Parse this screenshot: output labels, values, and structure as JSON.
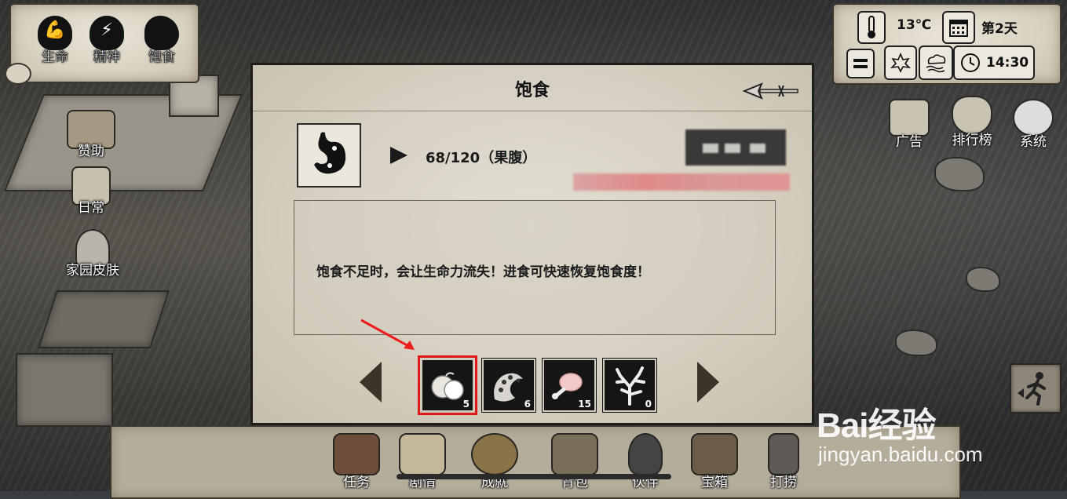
{
  "status": {
    "items": [
      {
        "label": "生命",
        "icon": "muscle-icon"
      },
      {
        "label": "精神",
        "icon": "lightning-head-icon"
      },
      {
        "label": "饱食",
        "icon": "stomach-icon"
      }
    ]
  },
  "weather": {
    "temperature": "13℃",
    "day": "第2天",
    "time": "14:30",
    "icons": [
      "thermometer-icon",
      "calendar-icon",
      "menu-icon",
      "leaf-icon",
      "cloud-icon",
      "clock-icon"
    ]
  },
  "left_menu": [
    {
      "label": "赞助",
      "icon": "winged-chest-icon"
    },
    {
      "label": "日常",
      "icon": "quill-scroll-icon"
    },
    {
      "label": "家园皮肤",
      "icon": "viking-helmet-icon"
    }
  ],
  "right_menu": [
    {
      "label": "广告",
      "icon": "ad-scroll-icon"
    },
    {
      "label": "排行榜",
      "icon": "trophy-icon"
    },
    {
      "label": "系统",
      "icon": "gear-icon"
    }
  ],
  "dialog": {
    "title": "饱食",
    "value": "68/120（果腹）",
    "description": "饱食不足时，会让生命力流失！进食可快速恢复饱食度！",
    "foods": [
      {
        "icon": "coconut-icon",
        "count": "5",
        "selected": true
      },
      {
        "icon": "tentacle-icon",
        "count": "6",
        "selected": false
      },
      {
        "icon": "meat-icon",
        "count": "15",
        "selected": false
      },
      {
        "icon": "coral-icon",
        "count": "0",
        "selected": false
      }
    ]
  },
  "bottom_menu": [
    {
      "label": "任务",
      "icon": "book-icon"
    },
    {
      "label": "剧情",
      "icon": "map-scroll-icon"
    },
    {
      "label": "成就",
      "icon": "medal-icon"
    },
    {
      "label": "背包",
      "icon": "backpack-icon"
    },
    {
      "label": "伙伴",
      "icon": "penguin-icon"
    },
    {
      "label": "宝箱",
      "icon": "treasure-chest-icon"
    },
    {
      "label": "打捞",
      "icon": "grappling-hook-icon"
    }
  ],
  "watermark": {
    "brand": "Bai经验",
    "url": "jingyan.baidu.com"
  }
}
